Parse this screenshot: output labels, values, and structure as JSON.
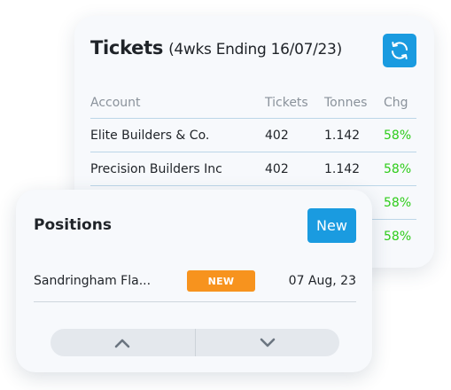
{
  "tickets": {
    "title": "Tickets",
    "subtitle": "(4wks Ending 16/07/23)",
    "refresh_icon": "refresh-icon",
    "columns": [
      "Account",
      "Tickets",
      "Tonnes",
      "Chg"
    ],
    "rows": [
      {
        "account": "Elite Builders & Co.",
        "tickets": "402",
        "tonnes": "1.142",
        "chg": "58%"
      },
      {
        "account": "Precision Builders Inc",
        "tickets": "402",
        "tonnes": "1.142",
        "chg": "58%"
      },
      {
        "account": "",
        "tickets": "",
        "tonnes": "",
        "chg": "58%"
      },
      {
        "account": "",
        "tickets": "",
        "tonnes": "",
        "chg": "58%"
      }
    ],
    "colors": {
      "accent": "#1a9be0",
      "positive": "#2ecc1a"
    }
  },
  "positions": {
    "title": "Positions",
    "new_button": "New",
    "items": [
      {
        "name": "Sandringham Fla...",
        "badge": "NEW",
        "date": "07 Aug, 23"
      }
    ],
    "pager": {
      "up_icon": "chevron-up-icon",
      "down_icon": "chevron-down-icon"
    },
    "colors": {
      "badge": "#f7931e"
    }
  }
}
